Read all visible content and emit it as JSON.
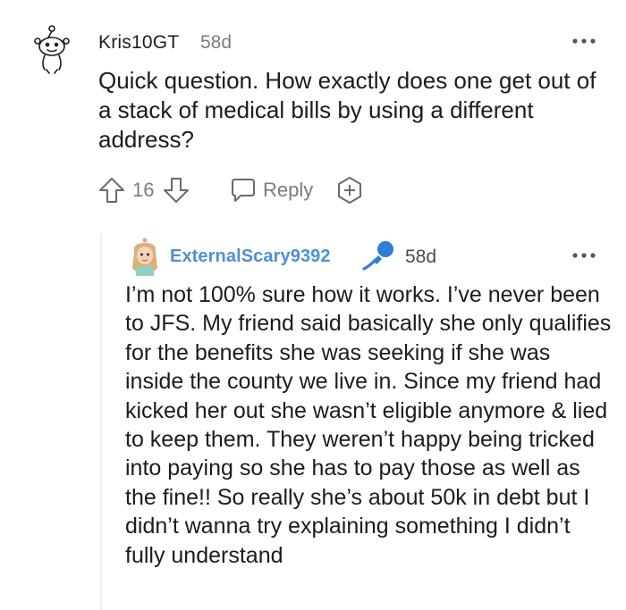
{
  "comment": {
    "author": "Kris10GT",
    "age": "58d",
    "body": "Quick question. How exactly does one get out of a stack of medical bills by using a different address?",
    "votes": "16",
    "reply_label": "Reply",
    "icons": {
      "avatar": "snoo-avatar-icon",
      "more": "more-options-icon",
      "upvote": "upvote-arrow-icon",
      "downvote": "downvote-arrow-icon",
      "reply": "reply-bubble-icon",
      "award": "award-plus-icon"
    }
  },
  "reply": {
    "author": "ExternalScary9392",
    "age": "58d",
    "author_color": "#4f8fd6",
    "body": "I’m not 100% sure how it works. I’ve never been to JFS. My friend said basically she only qualifies for the benefits she was seeking if she was inside the county we live in. Since my friend had kicked her out she wasn’t eligible anymore & lied to keep them. They weren’t happy being tricked into paying so she has to pay those as well as the fine!! So really she’s about 50k in debt but I didn’t wanna try explaining something I didn’t fully understand",
    "icons": {
      "avatar": "user-avatar-icon",
      "badge": "microphone-icon",
      "more": "more-options-icon"
    }
  }
}
